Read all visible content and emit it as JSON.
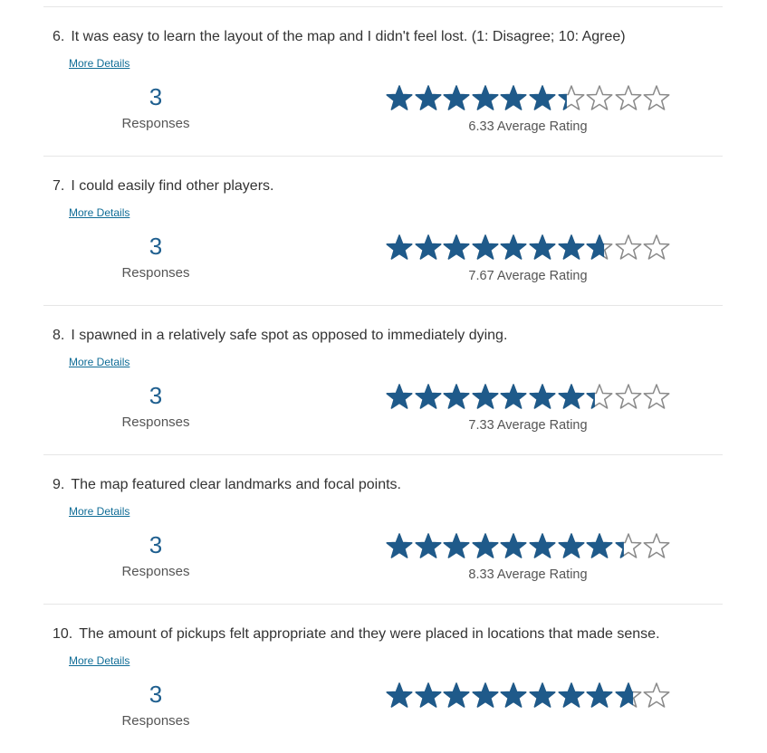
{
  "colors": {
    "star_filled": "#1f5a8a",
    "star_empty": "#8a8a8a",
    "link": "#0f6c96",
    "count": "#1f5f8f"
  },
  "questions": [
    {
      "number": "6.",
      "text": "It was easy to learn the layout of the map and I didn't feel lost. (1: Disagree; 10: Agree)",
      "more_details": "More Details",
      "responses_count": "3",
      "responses_label": "Responses",
      "rating": 6.33,
      "max_rating": 10,
      "average_label": "6.33 Average Rating"
    },
    {
      "number": "7.",
      "text": "I could easily find other players.",
      "more_details": "More Details",
      "responses_count": "3",
      "responses_label": "Responses",
      "rating": 7.67,
      "max_rating": 10,
      "average_label": "7.67 Average Rating"
    },
    {
      "number": "8.",
      "text": "I spawned in a relatively safe spot as opposed to immediately dying.",
      "more_details": "More Details",
      "responses_count": "3",
      "responses_label": "Responses",
      "rating": 7.33,
      "max_rating": 10,
      "average_label": "7.33 Average Rating"
    },
    {
      "number": "9.",
      "text": "The map featured clear landmarks and focal points.",
      "more_details": "More Details",
      "responses_count": "3",
      "responses_label": "Responses",
      "rating": 8.33,
      "max_rating": 10,
      "average_label": "8.33 Average Rating"
    },
    {
      "number": "10.",
      "text": "The amount of pickups felt appropriate and they were placed in locations that made sense.",
      "more_details": "More Details",
      "responses_count": "3",
      "responses_label": "Responses",
      "rating": 8.67,
      "max_rating": 10,
      "average_label": ""
    }
  ]
}
